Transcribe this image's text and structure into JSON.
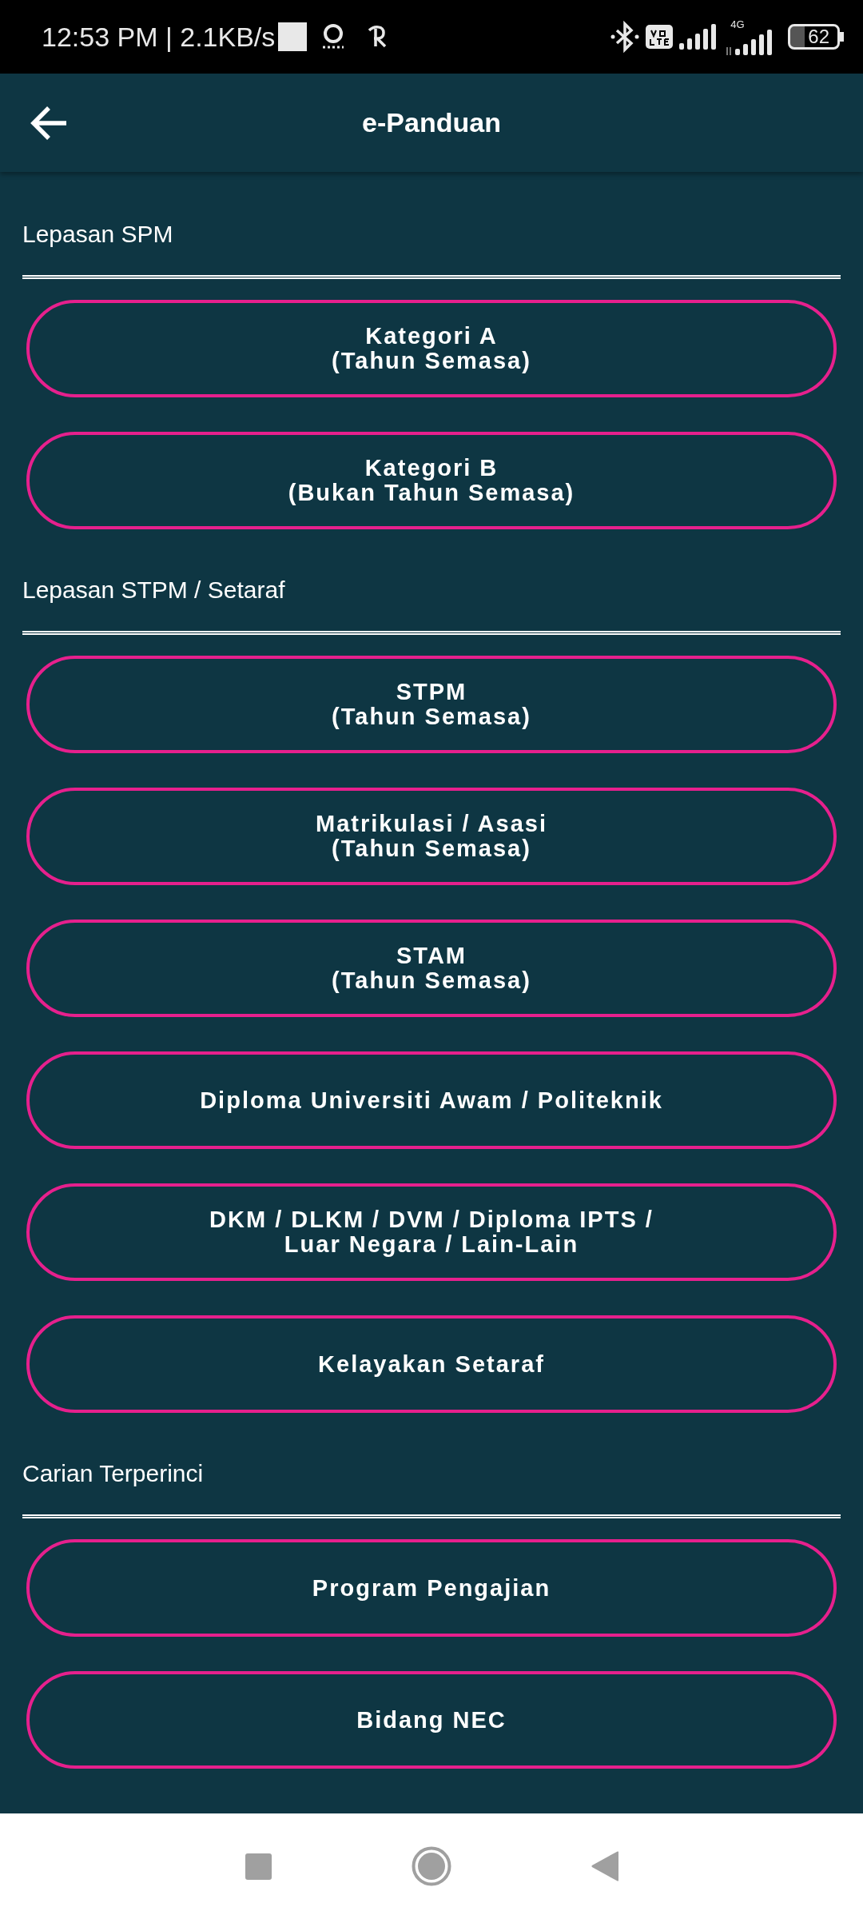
{
  "status_bar": {
    "time": "12:53 PM | 2.1KB/s",
    "network_label": "4G",
    "battery": "62"
  },
  "app_bar": {
    "title": "e-Panduan"
  },
  "sections": [
    {
      "title": "Lepasan SPM",
      "buttons": [
        {
          "lines": [
            "Kategori A",
            "(Tahun Semasa)"
          ]
        },
        {
          "lines": [
            "Kategori B",
            "(Bukan Tahun Semasa)"
          ]
        }
      ]
    },
    {
      "title": "Lepasan STPM / Setaraf",
      "buttons": [
        {
          "lines": [
            "STPM",
            "(Tahun Semasa)"
          ]
        },
        {
          "lines": [
            "Matrikulasi / Asasi",
            "(Tahun Semasa)"
          ]
        },
        {
          "lines": [
            "STAM",
            "(Tahun Semasa)"
          ]
        },
        {
          "lines": [
            "Diploma Universiti Awam / Politeknik"
          ]
        },
        {
          "lines": [
            "DKM / DLKM / DVM / Diploma IPTS /",
            "Luar Negara / Lain-Lain"
          ]
        },
        {
          "lines": [
            "Kelayakan Setaraf"
          ]
        }
      ]
    },
    {
      "title": "Carian Terperinci",
      "buttons": [
        {
          "lines": [
            "Program Pengajian"
          ]
        },
        {
          "lines": [
            "Bidang NEC"
          ]
        }
      ]
    }
  ]
}
